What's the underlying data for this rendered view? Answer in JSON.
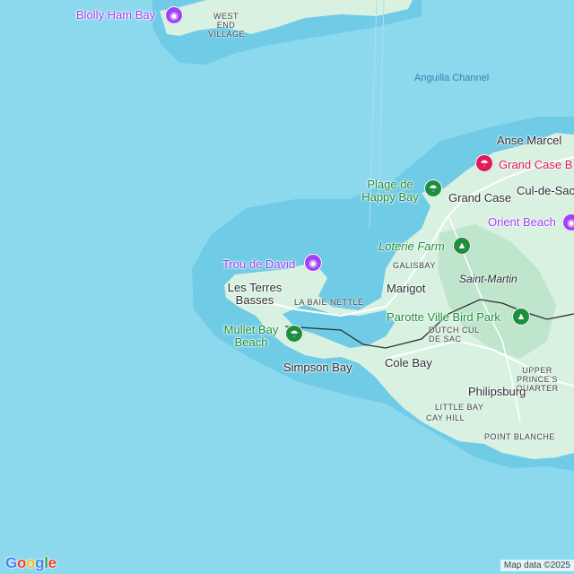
{
  "colors": {
    "ocean": "#8cd8ed",
    "shallow": "#6fcbe6",
    "land": "#d8f1e0",
    "land_dark": "#bfe5cd",
    "road": "#ffffff",
    "border": "#2b2f33",
    "poi_purple": "#a142f4",
    "poi_pink": "#e0195b",
    "poi_green": "#1e8e3e"
  },
  "places": {
    "blolly_ham_bay": "Blolly Ham Bay",
    "west_end_village": "WEST END VILLAGE",
    "anse_marcel": "Anse Marcel",
    "grand_case": "Grand Case",
    "grand_case_beach": "Grand Case B",
    "cul_de_sac": "Cul-de-Sac",
    "orient_beach": "Orient Beach",
    "plage_de_happy_bay": "Plage de Happy Bay",
    "loterie_farm": "Loterie Farm",
    "galisbay": "GALISBAY",
    "saint_martin": "Saint-Martin",
    "marigot": "Marigot",
    "trou_de_david": "Trou de David",
    "les_terres_basses": "Les Terres Basses",
    "la_baie_nettle": "LA BAIE NETTLÉ",
    "mullet_bay_beach": "Mullet Bay Beach",
    "parotte_ville_bird_park": "Parotte Ville Bird Park",
    "dutch_cul_de_sac": "DUTCH CUL DE SAC",
    "simpson_bay": "Simpson Bay",
    "cole_bay": "Cole Bay",
    "upper_princes_quarter": "UPPER PRINCE'S QUARTER",
    "philipsburg": "Philipsburg",
    "little_bay": "LITTLE BAY",
    "cay_hill": "CAY HILL",
    "point_blanche": "POINT BLANCHE"
  },
  "water": {
    "anguilla_channel": "Anguilla Channel"
  },
  "icons": {
    "camera": "camera-icon",
    "beach": "beach-umbrella-icon",
    "tree": "tree-icon"
  },
  "attribution": "Map data ©2025",
  "logo": {
    "g1": "G",
    "o1": "o",
    "o2": "o",
    "g2": "g",
    "l": "l",
    "e": "e"
  }
}
